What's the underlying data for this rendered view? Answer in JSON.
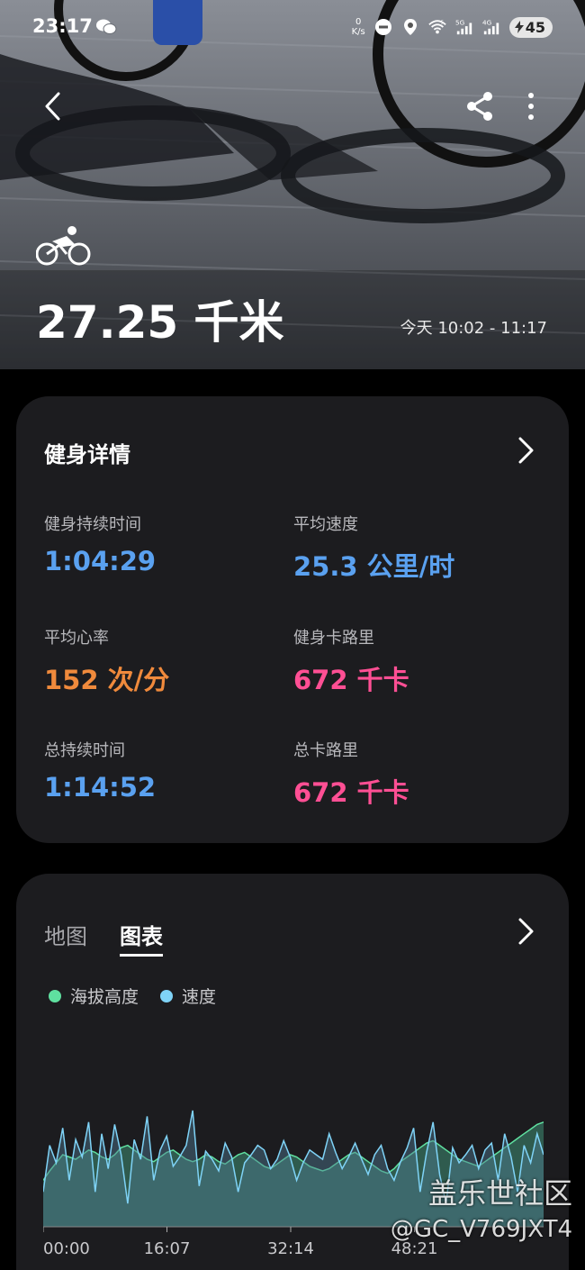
{
  "status_bar": {
    "time": "23:17",
    "net_speed_value": "0",
    "net_speed_unit": "K/s",
    "sig1": "5G",
    "sig2": "4G",
    "wifi_badge": "5",
    "battery": "45"
  },
  "workout": {
    "distance": "27.25 千米",
    "date_range": "今天 10:02 - 11:17"
  },
  "details": {
    "title": "健身详情",
    "metrics": [
      {
        "label": "健身持续时间",
        "value": "1:04:29",
        "color": "#5aa1f0"
      },
      {
        "label": "平均速度",
        "value": "25.3 公里/时",
        "color": "#5aa1f0"
      },
      {
        "label": "平均心率",
        "value": "152 次/分",
        "color": "#f08a3c"
      },
      {
        "label": "健身卡路里",
        "value": "672 千卡",
        "color": "#ff4f94"
      },
      {
        "label": "总持续时间",
        "value": "1:14:52",
        "color": "#5aa1f0"
      },
      {
        "label": "总卡路里",
        "value": "672 千卡",
        "color": "#ff4f94"
      }
    ]
  },
  "chart_panel": {
    "tabs": [
      "地图",
      "图表"
    ],
    "active_tab": "图表",
    "legend": [
      {
        "name": "海拔高度",
        "color": "#5fe0a0"
      },
      {
        "name": "速度",
        "color": "#7fd3f7"
      }
    ]
  },
  "chart_data": {
    "type": "area",
    "x_ticks": [
      "00:00",
      "16:07",
      "32:14",
      "48:21"
    ],
    "series": [
      {
        "name": "海拔高度",
        "values": [
          40,
          48,
          55,
          62,
          60,
          58,
          62,
          66,
          64,
          60,
          58,
          62,
          68,
          70,
          66,
          62,
          58,
          56,
          60,
          64,
          66,
          62,
          58,
          56,
          58,
          62,
          60,
          56,
          54,
          58,
          62,
          64,
          60,
          56,
          52,
          50,
          54,
          58,
          62,
          60,
          56,
          52,
          50,
          48,
          50,
          54,
          58,
          62,
          64,
          60,
          56,
          52,
          48,
          46,
          50,
          56,
          60,
          64,
          68,
          72,
          74,
          70,
          66,
          62,
          58,
          56,
          54,
          52,
          56,
          60,
          64,
          68,
          72,
          76,
          80,
          84,
          88,
          90
        ]
      },
      {
        "name": "速度",
        "values": [
          30,
          70,
          55,
          85,
          40,
          75,
          60,
          90,
          30,
          80,
          50,
          88,
          62,
          20,
          75,
          58,
          95,
          40,
          66,
          78,
          52,
          60,
          70,
          100,
          35,
          65,
          58,
          48,
          72,
          60,
          30,
          55,
          62,
          70,
          66,
          50,
          58,
          74,
          60,
          40,
          55,
          66,
          62,
          58,
          80,
          64,
          50,
          60,
          72,
          58,
          45,
          62,
          70,
          50,
          40,
          56,
          68,
          85,
          30,
          64,
          90,
          45,
          20,
          68,
          55,
          62,
          70,
          50,
          66,
          72,
          40,
          80,
          60,
          30,
          70,
          55,
          80,
          62
        ]
      }
    ],
    "ylim": [
      0,
      110
    ]
  },
  "watermark": {
    "line1": "盖乐世社区",
    "line2": "@GC_V769JXT4"
  }
}
